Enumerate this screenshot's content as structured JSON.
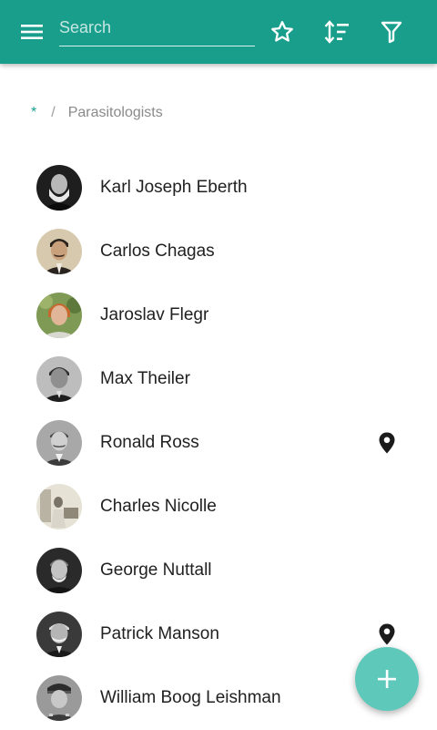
{
  "toolbar": {
    "search_placeholder": "Search",
    "menu_icon": "menu-icon",
    "favorite_icon": "star-outline-icon",
    "sort_icon": "sort-icon",
    "filter_icon": "filter-icon",
    "accent_color": "#1a9e8c"
  },
  "breadcrumb": {
    "root": "*",
    "separator": "/",
    "current": "Parasitologists"
  },
  "people": [
    {
      "name": "Karl Joseph Eberth",
      "has_location": false,
      "avatar_tone": "#3a3a3a"
    },
    {
      "name": "Carlos Chagas",
      "has_location": false,
      "avatar_tone": "#b8a58a"
    },
    {
      "name": "Jaroslav Flegr",
      "has_location": false,
      "avatar_tone": "#6e8a4e"
    },
    {
      "name": "Max Theiler",
      "has_location": false,
      "avatar_tone": "#7a7a7a"
    },
    {
      "name": "Ronald Ross",
      "has_location": true,
      "avatar_tone": "#8c8c8c"
    },
    {
      "name": "Charles Nicolle",
      "has_location": false,
      "avatar_tone": "#cfcabd"
    },
    {
      "name": "George Nuttall",
      "has_location": false,
      "avatar_tone": "#4a4a4a"
    },
    {
      "name": "Patrick Manson",
      "has_location": true,
      "avatar_tone": "#5a5a5a"
    },
    {
      "name": "William Boog Leishman",
      "has_location": false,
      "avatar_tone": "#6b6b6b"
    }
  ],
  "fab": {
    "icon": "plus-icon",
    "color": "#5ec8bb"
  }
}
